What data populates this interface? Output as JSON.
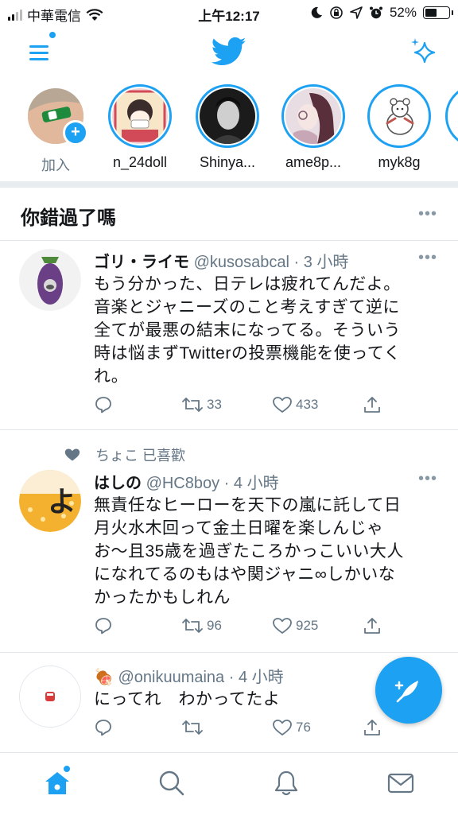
{
  "status_bar": {
    "carrier": "中華電信",
    "time": "上午12:17",
    "battery": "52%",
    "battery_level": 0.52
  },
  "stories": [
    {
      "name": "加入",
      "is_add": true
    },
    {
      "name": "n_24doll"
    },
    {
      "name": "Shinya..."
    },
    {
      "name": "ame8p..."
    },
    {
      "name": "myk8g"
    }
  ],
  "section_title": "你錯過了嗎",
  "more_dots": "•••",
  "tweets": [
    {
      "name": "ゴリ・ライモ",
      "meta": "@kusosabcal · 3 小時",
      "lines": [
        "もう分かった、日テレは疲れてんだよ。",
        "音楽とジャニーズのこと考えすぎて逆に",
        "全てが最悪の結末になってる。そういう",
        "時は悩まずTwitterの投票機能を使ってく",
        "れ。"
      ],
      "retweets": "33",
      "likes": "433"
    },
    {
      "liked_by": "ちょこ 已喜歡",
      "name": "はしの",
      "meta": "@HC8boy · 4 小時",
      "lines": [
        "無責任なヒーローを天下の嵐に託して日",
        "月火水木回って金土日曜を楽しんじゃ",
        "お～且35歳を過ぎたころかっこいい大人",
        "になれてるのもはや関ジャニ∞しかいな",
        "かったかもしれん"
      ],
      "retweets": "96",
      "likes": "925"
    },
    {
      "name": "🍖",
      "meta": "@onikuumaina · 4 小時",
      "lines": [
        "にってれ　わかってたよ"
      ],
      "retweets": "",
      "likes": "76"
    }
  ],
  "tabs": [
    "home-icon",
    "search-icon",
    "notifications-icon",
    "messages-icon"
  ],
  "colors": {
    "accent": "#1da1f2",
    "text": "#14171a",
    "muted": "#657786"
  }
}
